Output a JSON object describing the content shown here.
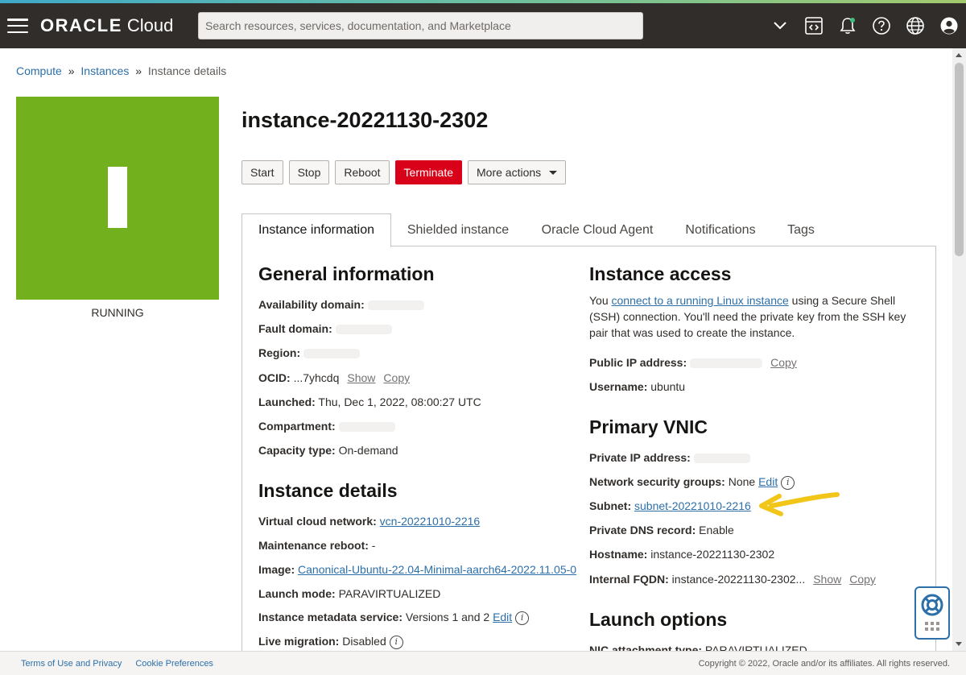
{
  "header": {
    "brand_main": "ORACLE",
    "brand_sub": "Cloud",
    "search_placeholder": "Search resources, services, documentation, and Marketplace",
    "icons": [
      "chevron-down-icon",
      "code-editor-icon",
      "bell-icon",
      "help-icon",
      "globe-icon",
      "user-icon"
    ]
  },
  "breadcrumb": {
    "items": [
      "Compute",
      "Instances",
      "Instance details"
    ],
    "separator": "»"
  },
  "instance": {
    "tile_color": "#72b01e",
    "tile_letter": "I",
    "status": "RUNNING",
    "name": "instance-20221130-2302"
  },
  "actions": {
    "start": "Start",
    "stop": "Stop",
    "reboot": "Reboot",
    "terminate": "Terminate",
    "more": "More actions"
  },
  "tabs": [
    "Instance information",
    "Shielded instance",
    "Oracle Cloud Agent",
    "Notifications",
    "Tags"
  ],
  "general": {
    "heading": "General information",
    "availability_domain": "Availability domain:",
    "fault_domain": "Fault domain:",
    "region": "Region:",
    "ocid_label": "OCID:",
    "ocid_value": "...7yhcdq",
    "show": "Show",
    "copy": "Copy",
    "launched_label": "Launched:",
    "launched_value": "Thu, Dec 1, 2022, 08:00:27 UTC",
    "compartment": "Compartment:",
    "capacity_label": "Capacity type:",
    "capacity_value": "On-demand"
  },
  "details": {
    "heading": "Instance details",
    "vcn_label": "Virtual cloud network:",
    "vcn_value": "vcn-20221010-2216",
    "maint_label": "Maintenance reboot:",
    "maint_value": "-",
    "image_label": "Image:",
    "image_value": "Canonical-Ubuntu-22.04-Minimal-aarch64-2022.11.05-0",
    "launch_mode_label": "Launch mode:",
    "launch_mode_value": "PARAVIRTUALIZED",
    "metadata_label": "Instance metadata service:",
    "metadata_value": "Versions 1 and 2",
    "edit": "Edit",
    "live_migration_label": "Live migration:",
    "live_migration_value": "Disabled"
  },
  "access": {
    "heading": "Instance access",
    "desc_pre": "You ",
    "desc_link": "connect to a running Linux instance",
    "desc_post": " using a Secure Shell (SSH) connection. You'll need the private key from the SSH key pair that was used to create the instance.",
    "public_ip_label": "Public IP address:",
    "copy": "Copy",
    "username_label": "Username:",
    "username_value": "ubuntu"
  },
  "vnic": {
    "heading": "Primary VNIC",
    "private_ip_label": "Private IP address:",
    "nsg_label": "Network security groups:",
    "nsg_value": "None",
    "edit": "Edit",
    "subnet_label": "Subnet:",
    "subnet_value": "subnet-20221010-2216",
    "dns_label": "Private DNS record:",
    "dns_value": "Enable",
    "hostname_label": "Hostname:",
    "hostname_value": "instance-20221130-2302",
    "fqdn_label": "Internal FQDN:",
    "fqdn_value": "instance-20221130-2302...",
    "show": "Show",
    "copy": "Copy"
  },
  "launch": {
    "heading": "Launch options",
    "nic_label": "NIC attachment type:",
    "nic_value": "PARAVIRTUALIZED"
  },
  "footer": {
    "terms": "Terms of Use and Privacy",
    "cookies": "Cookie Preferences",
    "copyright": "Copyright © 2022, Oracle and/or its affiliates. All rights reserved."
  },
  "colors": {
    "header_bg": "#312d2a",
    "running": "#72b01e",
    "terminate": "#d90019",
    "link": "#2c6fa9",
    "highlight_arrow": "#f2c618"
  }
}
